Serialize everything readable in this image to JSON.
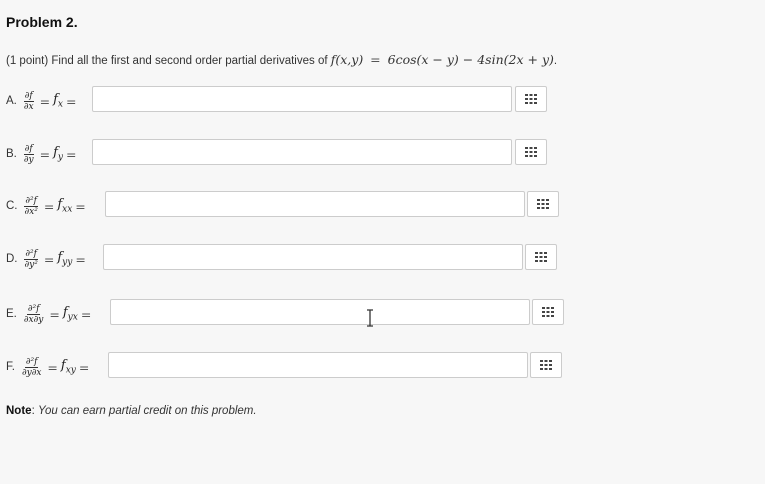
{
  "problem": {
    "title": "Problem 2.",
    "points": "(1 point)",
    "prompt": "Find all the first and second order partial derivatives of",
    "function_lhs": "f(x,y)",
    "function_rhs": "6cos(x − y) − 4sin(2x + y)"
  },
  "parts": [
    {
      "letter": "A.",
      "num": "∂f",
      "den": "∂x",
      "symbol": "f",
      "sub": "x",
      "value": ""
    },
    {
      "letter": "B.",
      "num": "∂f",
      "den": "∂y",
      "symbol": "f",
      "sub": "y",
      "value": ""
    },
    {
      "letter": "C.",
      "num": "∂²f",
      "den": "∂x²",
      "symbol": "f",
      "sub": "xx",
      "value": ""
    },
    {
      "letter": "D.",
      "num": "∂²f",
      "den": "∂y²",
      "symbol": "f",
      "sub": "yy",
      "value": ""
    },
    {
      "letter": "E.",
      "num": "∂²f",
      "den": "∂x∂y",
      "symbol": "f",
      "sub": "yx",
      "value": ""
    },
    {
      "letter": "F.",
      "num": "∂²f",
      "den": "∂y∂x",
      "symbol": "f",
      "sub": "xy",
      "value": ""
    }
  ],
  "note": {
    "label": "Note",
    "text": "You can earn partial credit on this problem."
  },
  "colors": {
    "background": "#f7f7f7",
    "input_border": "#cccccc",
    "grid_icon": "#444444"
  },
  "icons": {
    "equation_editor": "grid-icon",
    "pointer": "text-cursor-icon"
  }
}
